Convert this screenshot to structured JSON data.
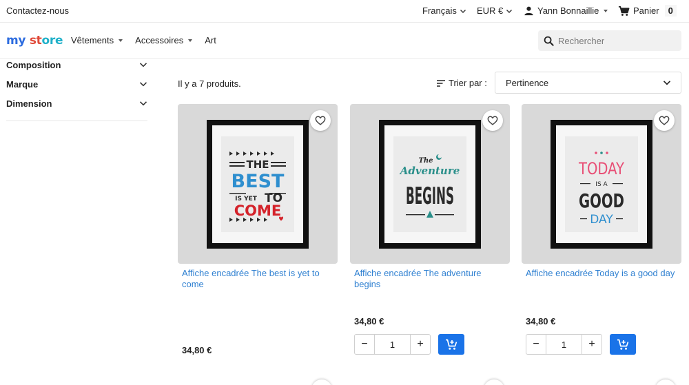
{
  "topbar": {
    "contact": "Contactez-nous",
    "language": "Français",
    "currency": "EUR €",
    "user": "Yann Bonnaillie",
    "cart_label": "Panier",
    "cart_count": "0"
  },
  "header": {
    "logo": [
      "my",
      " ",
      "st",
      "ore"
    ],
    "nav": [
      {
        "label": "Vêtements"
      },
      {
        "label": "Accessoires"
      },
      {
        "label": "Art"
      }
    ],
    "search_placeholder": "Rechercher"
  },
  "sidebar": {
    "filters": [
      {
        "label": "Composition"
      },
      {
        "label": "Marque"
      },
      {
        "label": "Dimension"
      }
    ]
  },
  "listing": {
    "count": "Il y a 7 produits.",
    "sort_label": "Trier par :",
    "sort_value": "Pertinence"
  },
  "products": [
    {
      "name": "Affiche encadrée The best is yet to come",
      "price": "34,80 €",
      "qty": "1",
      "art": {
        "line1": "THE",
        "line2": "BEST",
        "line3a": "IS YET",
        "line3b": "TO",
        "line4": "COME"
      }
    },
    {
      "name": "Affiche encadrée The adventure begins",
      "price": "34,80 €",
      "qty": "1",
      "art": {
        "line1": "The",
        "line2": "Adventure",
        "line3": "BEGINS"
      }
    },
    {
      "name": "Affiche encadrée Today is a good day",
      "price": "34,80 €",
      "qty": "1",
      "art": {
        "line1": "TODAY",
        "line2": "IS A",
        "line3": "GOOD",
        "line4": "DAY"
      }
    }
  ],
  "colors": {
    "link": "#2f80d1",
    "accent": "#1a73e8",
    "thumb_bg": "#d9d9d9",
    "poster_red": "#d4222a",
    "poster_teal": "#2a8f8a",
    "poster_pink": "#e84f76",
    "poster_blue": "#2f8fcf"
  }
}
